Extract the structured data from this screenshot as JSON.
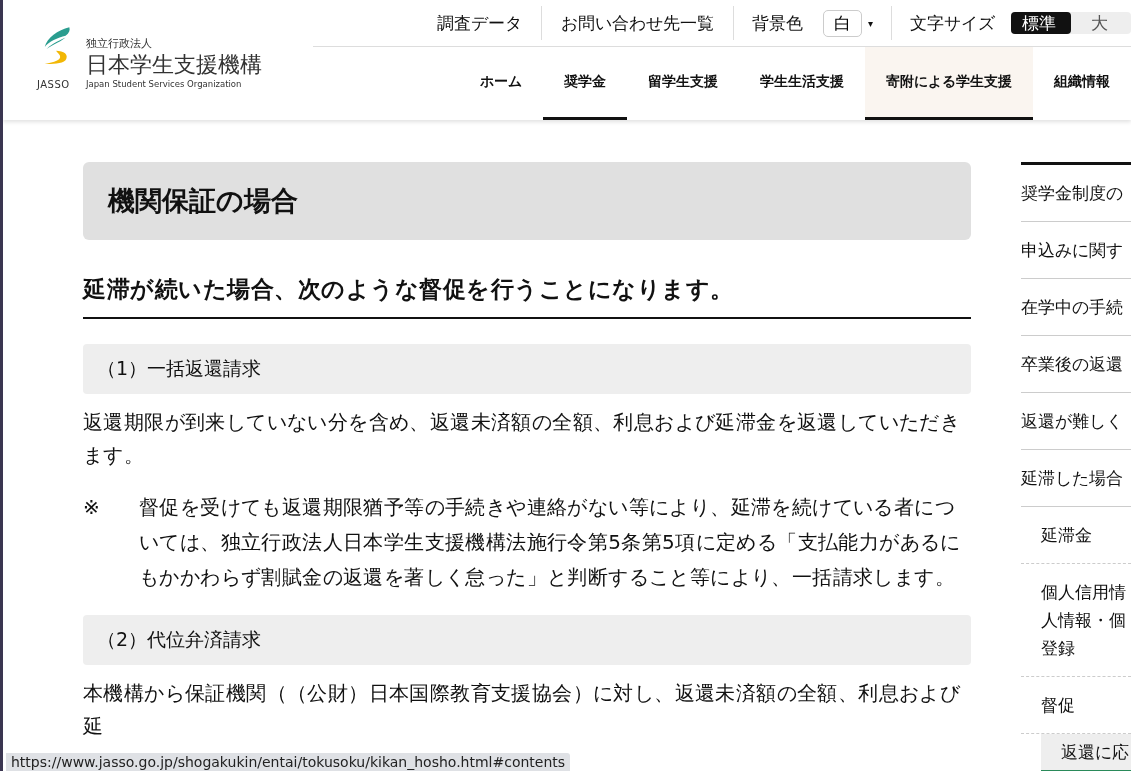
{
  "logo": {
    "org_type": "独立行政法人",
    "name": "日本学生支援機構",
    "english": "Japan Student Services Organization",
    "abbr": "JASSO"
  },
  "utility_links": [
    "調査データ",
    "お問い合わせ先一覧"
  ],
  "background_color": {
    "label": "背景色",
    "value": "白",
    "caret": "▾"
  },
  "font_size": {
    "label": "文字サイズ",
    "options": [
      {
        "label": "標準",
        "selected": true
      },
      {
        "label": "大",
        "selected": false
      }
    ]
  },
  "nav": [
    {
      "label": "ホーム",
      "selected": false,
      "hovered": false
    },
    {
      "label": "奨学金",
      "selected": true,
      "hovered": false
    },
    {
      "label": "留学生支援",
      "selected": false,
      "hovered": false
    },
    {
      "label": "学生生活支援",
      "selected": false,
      "hovered": false
    },
    {
      "label": "寄附による学生支援",
      "selected": true,
      "hovered": true
    },
    {
      "label": "組織情報",
      "selected": false,
      "hovered": false
    }
  ],
  "page_title": "機関保証の場合",
  "lead_heading": "延滞が続いた場合、次のような督促を行うことになります。",
  "sections": [
    {
      "heading": "（1）一括返還請求",
      "paragraph": "返還期限が到来していない分を含め、返還未済額の全額、利息および延滞金を返還していただきます。",
      "note": {
        "mark": "※",
        "text": "督促を受けても返還期限猶予等の手続きや連絡がない等により、延滞を続けている者については、独立行政法人日本学生支援機構法施行令第5条第5項に定める「支払能力があるにもかかわらず割賦金の返還を著しく怠った」と判断すること等により、一括請求します。"
      }
    },
    {
      "heading": "（2）代位弁済請求",
      "paragraph": "本機構から保証機関（（公財）日本国際教育支援協会）に対し、返還未済額の全額、利息および延"
    }
  ],
  "sidebar": {
    "items": [
      {
        "lines": [
          "奨学金制度の"
        ]
      },
      {
        "lines": [
          "申込みに関す"
        ]
      },
      {
        "lines": [
          "在学中の手続"
        ]
      },
      {
        "lines": [
          "卒業後の返還"
        ]
      },
      {
        "lines": [
          "返還が難しく"
        ]
      },
      {
        "lines": [
          "延滞した場合"
        ],
        "children": [
          {
            "lines": [
              "延滞金"
            ]
          },
          {
            "lines": [
              "個人信用情",
              "人情報・個",
              "登録"
            ]
          },
          {
            "lines": [
              "督促"
            ],
            "children": [
              {
                "lines": [
                  "返還に応"
                ],
                "selected": true
              }
            ]
          }
        ]
      }
    ]
  },
  "status_bar": "https://www.jasso.go.jp/shogakukin/entai/tokusoku/kikan_hosho.html#contents"
}
